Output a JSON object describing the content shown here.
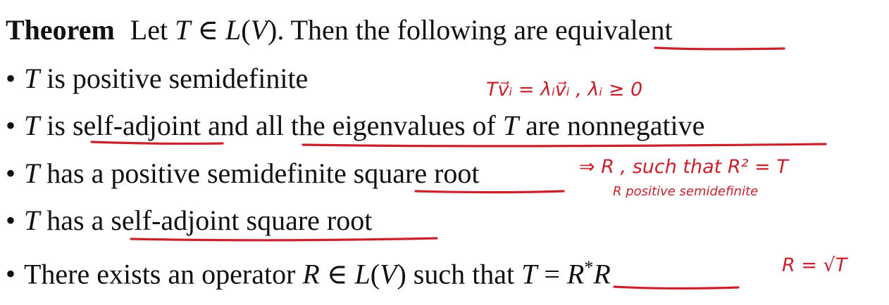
{
  "theorem": {
    "heading": "Theorem",
    "statement_pre": "Let ",
    "statement_T": "T",
    "statement_in": " ∈ ",
    "statement_L": "L",
    "statement_lp": "(",
    "statement_V": "V",
    "statement_rp": ")",
    "statement_post": ". Then the following are ",
    "statement_key": "equivalent"
  },
  "items": [
    {
      "bullet": "•",
      "subject": "T",
      "text": " is positive semidefinite"
    },
    {
      "bullet": "•",
      "subject": "T",
      "mid1": " is ",
      "u1": "self-adjoint",
      "mid2": " and ",
      "u2a": "all the eigenvalues of ",
      "u2T": "T",
      "u2b": " are nonnegative"
    },
    {
      "bullet": "•",
      "subject": "T",
      "mid1": " has a positive semidefinite ",
      "u1": "square root"
    },
    {
      "bullet": "•",
      "subject": "T",
      "mid1": " has a ",
      "u1": "self-adjoint square root"
    },
    {
      "bullet": "•",
      "pre": "There exists an operator ",
      "R": "R",
      "in": " ∈ ",
      "L": "L",
      "lp": "(",
      "V": "V",
      "rp": ")",
      "post": " such that ",
      "eqT": "T",
      "eq": " = ",
      "Rstar": "R",
      "star": "*",
      "R2": "R"
    }
  ],
  "annotations": {
    "note1": "Tv⃗ᵢ = λᵢv⃗ᵢ , λᵢ ≥ 0",
    "note2a": "⇒ R , such that R² = T",
    "note2b": "R positive semidefinite",
    "note3": "R = √T"
  },
  "colors": {
    "text": "#111111",
    "ink": "#c8232c"
  }
}
